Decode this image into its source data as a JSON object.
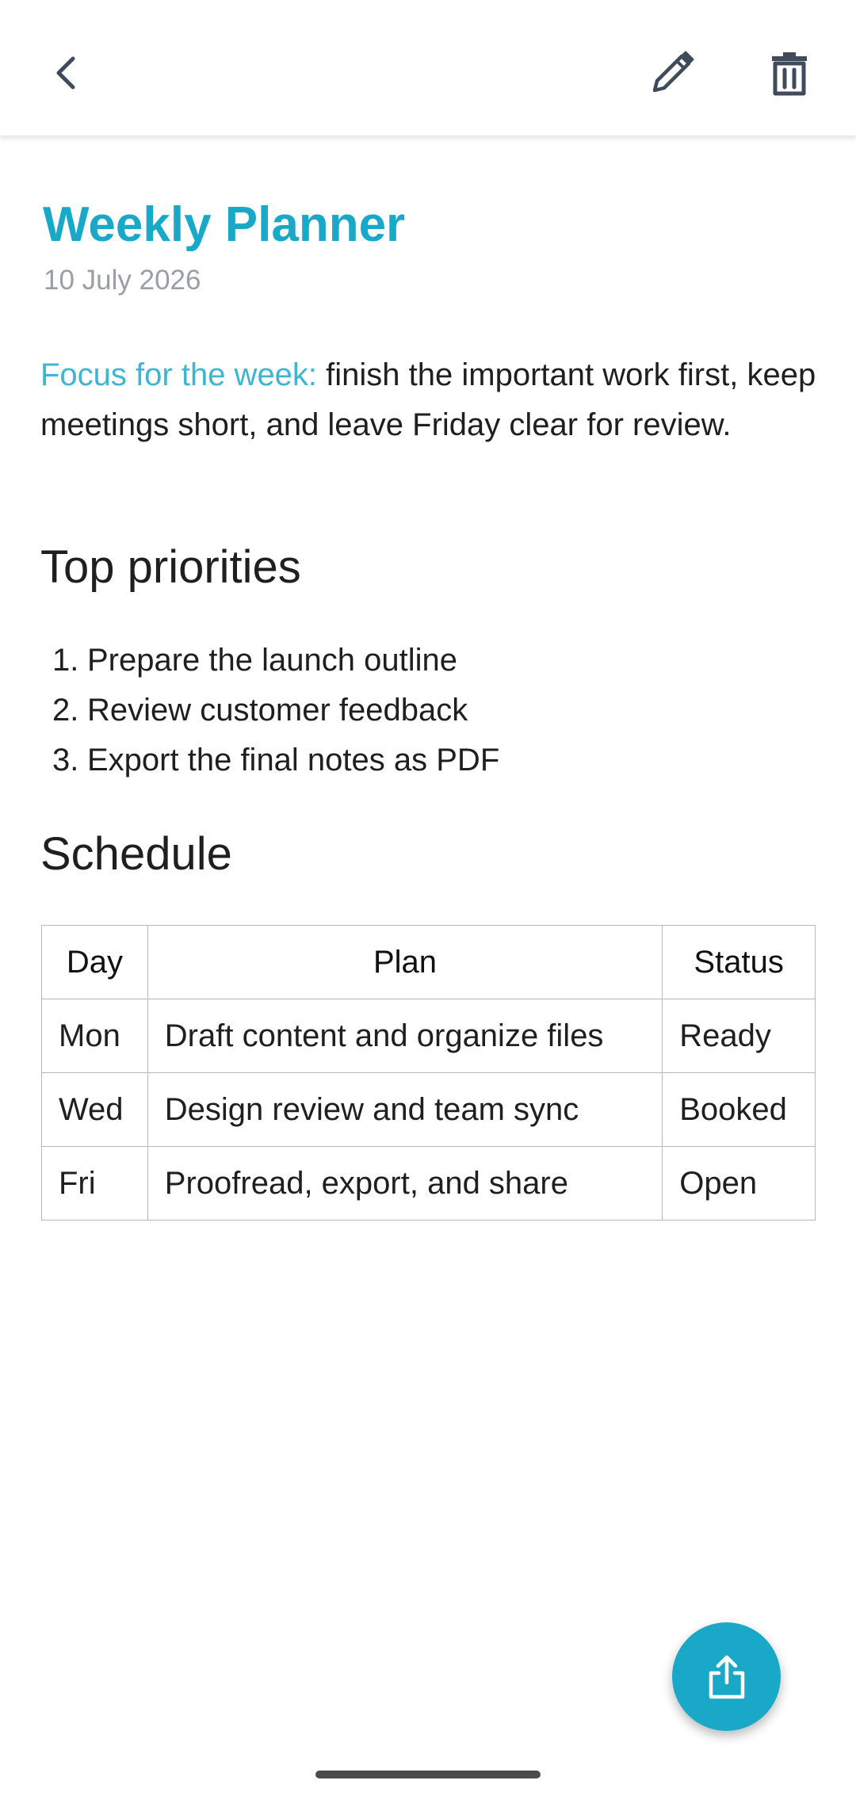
{
  "toolbar": {
    "back_icon": "chevron-left-icon",
    "edit_icon": "pencil-icon",
    "delete_icon": "trash-icon",
    "icon_color": "#3f4a5a"
  },
  "note": {
    "title": "Weekly Planner",
    "date": "10 July 2026",
    "focus_lead": "Focus for the week:",
    "focus_text": " finish the important work first, keep meetings short, and leave Friday clear for review.",
    "title_color": "#1aa8c8",
    "lead_color": "#3db5d3"
  },
  "priorities": {
    "heading": "Top priorities",
    "items": [
      {
        "num": "1.",
        "text": "Prepare the launch outline"
      },
      {
        "num": "2.",
        "text": "Review customer feedback"
      },
      {
        "num": "3.",
        "text": "Export the final notes as PDF"
      }
    ]
  },
  "schedule": {
    "heading": "Schedule",
    "columns": [
      "Day",
      "Plan",
      "Status"
    ],
    "rows": [
      [
        "Mon",
        "Draft content and organize files",
        "Ready"
      ],
      [
        "Wed",
        "Design review and team sync",
        "Booked"
      ],
      [
        "Fri",
        "Proofread, export, and share",
        "Open"
      ]
    ]
  },
  "fab": {
    "icon": "share-icon",
    "color": "#1aa8c8"
  }
}
